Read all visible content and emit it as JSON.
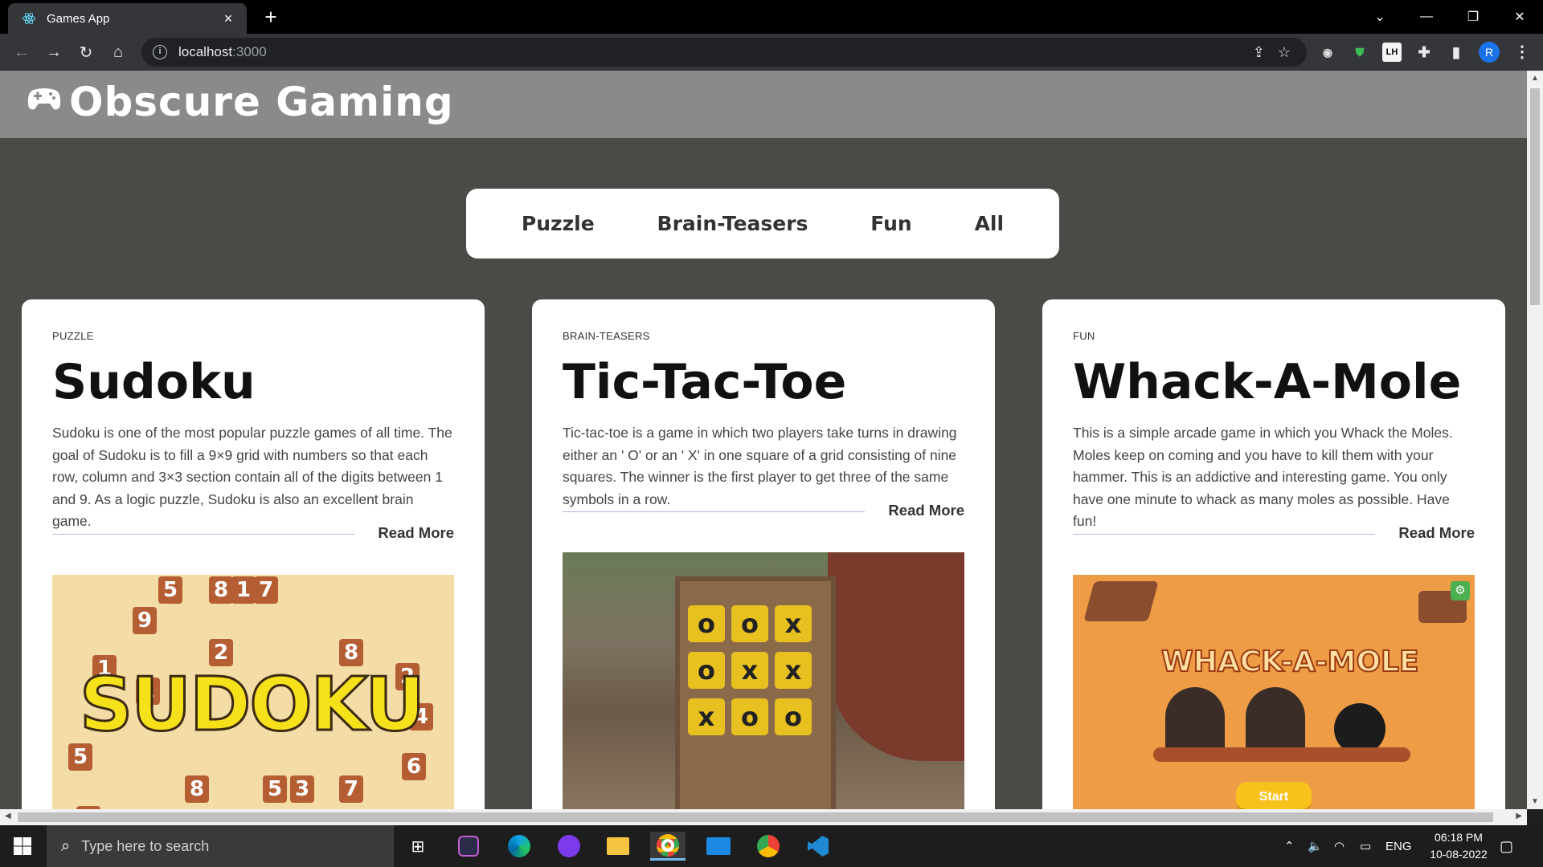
{
  "browser": {
    "tab_title": "Games App",
    "tab_close": "×",
    "new_tab": "+",
    "url_host": "localhost",
    "url_port": ":3000",
    "profile_initial": "R",
    "ext_lighthouse": "LH"
  },
  "site": {
    "title": "Obscure Gaming"
  },
  "filters": [
    "Puzzle",
    "Brain-Teasers",
    "Fun",
    "All"
  ],
  "cards": [
    {
      "category": "PUZZLE",
      "title": "Sudoku",
      "description": "Sudoku is one of the most popular puzzle games of all time. The goal of Sudoku is to fill a 9×9 grid with numbers so that each row, column and 3×3 section contain all of the digits between 1 and 9. As a logic puzzle, Sudoku is also an excellent brain game.",
      "read_more": "Read More",
      "image_text": "SUDOKU"
    },
    {
      "category": "BRAIN-TEASERS",
      "title": "Tic-Tac-Toe",
      "description": "Tic-tac-toe is a game in which two players take turns in drawing either an ' O' or an ' X' in one square of a grid consisting of nine squares. The winner is the first player to get three of the same symbols in a row.",
      "read_more": "Read More"
    },
    {
      "category": "FUN",
      "title": "Whack-A-Mole",
      "description": "This is a simple arcade game in which you Whack the Moles. Moles keep on coming and you have to kill them with your hammer. This is an addictive and interesting game. You only have one minute to whack as many moles as possible. Have fun!",
      "read_more": "Read More",
      "image_title": "WHACK-A-MOLE",
      "image_button": "Start"
    }
  ],
  "taskbar": {
    "search_placeholder": "Type here to search",
    "language": "ENG",
    "time": "06:18 PM",
    "date": "10-08-2022"
  }
}
